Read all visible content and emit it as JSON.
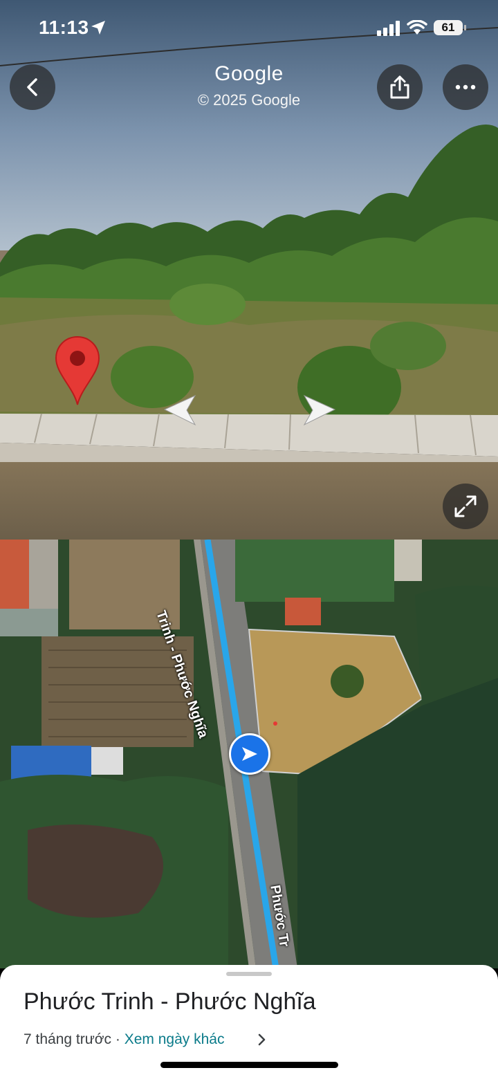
{
  "status_bar": {
    "time": "11:13",
    "battery": "61"
  },
  "street_view": {
    "title": "Google",
    "copyright": "© 2025 Google"
  },
  "map": {
    "road_label_1": "Trinh - Phước Nghĩa",
    "road_label_2": "Phước Tr"
  },
  "sheet": {
    "place_name": "Phước Trinh - Phước Nghĩa",
    "age": "7 tháng trước",
    "separator": " · ",
    "other_dates_link": "Xem ngày khác"
  },
  "icons": {
    "back": "chevron-left-icon",
    "share": "share-icon",
    "more": "more-horizontal-icon",
    "expand": "expand-icon",
    "pin": "map-pin-icon",
    "navigate": "navigation-arrow-icon"
  },
  "colors": {
    "pin": "#e53935",
    "route": "#29a6ea",
    "nav_dot": "#1a73e8",
    "link": "#0b7b8a"
  }
}
